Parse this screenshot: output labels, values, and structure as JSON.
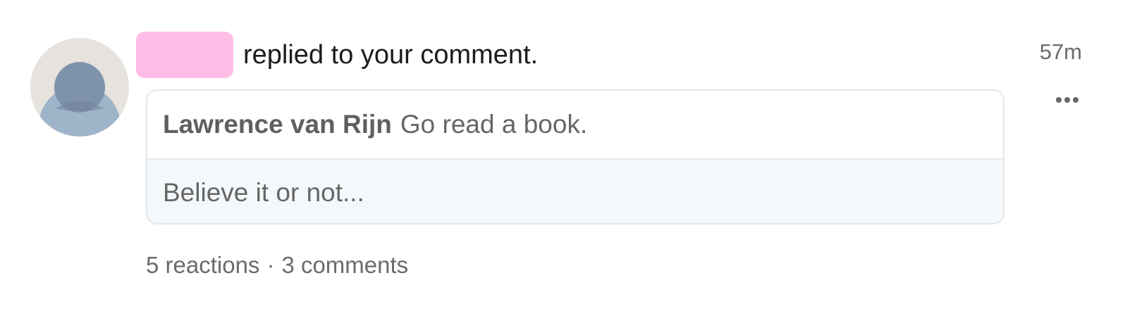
{
  "notification": {
    "avatar_icon": "default-user-avatar-icon",
    "redaction_color": "#ffbce6",
    "message": "replied to your comment.",
    "timestamp": "57m",
    "more_icon": "ellipsis-icon",
    "original_comment": {
      "author": "Lawrence van Rijn",
      "text": "Go read a book."
    },
    "reply": {
      "text": "Believe it or not..."
    },
    "stats": {
      "reactions": "5 reactions",
      "separator": "·",
      "comments": "3 comments"
    }
  }
}
